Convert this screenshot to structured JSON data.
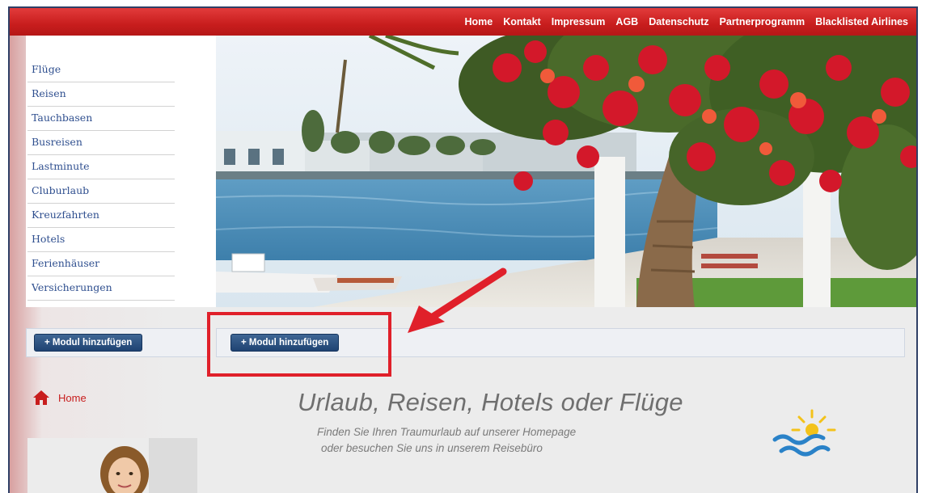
{
  "top_nav": {
    "items": [
      "Home",
      "Kontakt",
      "Impressum",
      "AGB",
      "Datenschutz",
      "Partnerprogramm",
      "Blacklisted Airlines"
    ]
  },
  "sidebar": {
    "items": [
      "Flüge",
      "Reisen",
      "Tauchbasen",
      "Busreisen",
      "Lastminute",
      "Cluburlaub",
      "Kreuzfahrten",
      "Hotels",
      "Ferienhäuser",
      "Versicherungen"
    ]
  },
  "modules": {
    "left_button": "+ Modul hinzufügen",
    "right_button": "+ Modul hinzufügen"
  },
  "breadcrumb": {
    "home": "Home"
  },
  "content": {
    "headline": "Urlaub, Reisen, Hotels oder Flüge",
    "subline_1": "Finden Sie Ihren Traumurlaub auf unserer Homepage",
    "subline_2": "oder besuchen Sie uns in unserem Reisebüro"
  },
  "colors": {
    "brand_red": "#c81d1d",
    "nav_blue": "#2f4f8f",
    "button_blue": "#1f4372",
    "highlight_red": "#e0202a"
  },
  "icons": [
    "home-icon",
    "sun-wave-logo-icon",
    "arrow-annotation-icon"
  ]
}
